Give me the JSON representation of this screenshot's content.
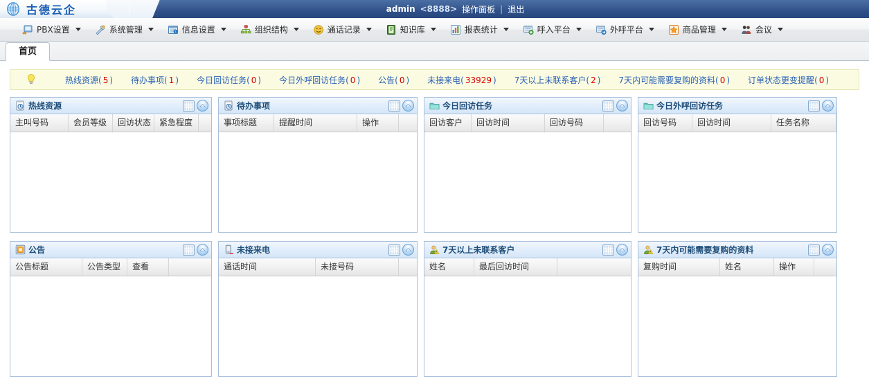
{
  "topbar": {
    "logo_text": "古德云企",
    "logo_icon": "globe-icon",
    "username": "admin",
    "extension": "<8888>",
    "panel_link": "操作面板",
    "separator": "|",
    "logout_link": "退出"
  },
  "menubar": {
    "items": [
      {
        "label": "PBX设置",
        "icon": "pbx-settings-icon"
      },
      {
        "label": "系统管理",
        "icon": "system-tools-icon"
      },
      {
        "label": "信息设置",
        "icon": "info-settings-icon"
      },
      {
        "label": "组织结构",
        "icon": "org-structure-icon"
      },
      {
        "label": "通话记录",
        "icon": "call-record-icon"
      },
      {
        "label": "知识库",
        "icon": "knowledge-book-icon"
      },
      {
        "label": "报表统计",
        "icon": "report-chart-icon"
      },
      {
        "label": "呼入平台",
        "icon": "inbound-platform-icon"
      },
      {
        "label": "外呼平台",
        "icon": "outbound-platform-icon"
      },
      {
        "label": "商品管理",
        "icon": "product-manage-icon"
      },
      {
        "label": "会议",
        "icon": "conference-icon"
      }
    ]
  },
  "tabs": [
    {
      "label": "首页",
      "active": true
    }
  ],
  "notice": {
    "icon": "lightbulb-icon",
    "links": [
      {
        "label": "热线资源",
        "count": "5"
      },
      {
        "label": "待办事项",
        "count": "1"
      },
      {
        "label": "今日回访任务",
        "count": "0"
      },
      {
        "label": "今日外呼回访任务",
        "count": "0"
      },
      {
        "label": "公告",
        "count": "0"
      },
      {
        "label": "未接来电",
        "count": "33929"
      },
      {
        "label": "7天以上未联系客户",
        "count": "2"
      },
      {
        "label": "7天内可能需要复购的资料",
        "count": "0"
      },
      {
        "label": "订单状态更变提醒",
        "count": "0"
      }
    ]
  },
  "panels": [
    {
      "title": "热线资源",
      "icon": "clock-doc-icon",
      "columns": [
        {
          "label": "主叫号码",
          "width": 84
        },
        {
          "label": "会员等级",
          "width": 64
        },
        {
          "label": "回访状态",
          "width": 60
        },
        {
          "label": "紧急程度",
          "width": 64
        },
        {
          "label": "",
          "width": 18
        }
      ],
      "rows": []
    },
    {
      "title": "待办事项",
      "icon": "clock-doc-icon",
      "columns": [
        {
          "label": "事项标题",
          "width": 80
        },
        {
          "label": "提醒时间",
          "width": 120
        },
        {
          "label": "操作",
          "width": 60
        },
        {
          "label": "",
          "width": 26
        }
      ],
      "rows": []
    },
    {
      "title": "今日回访任务",
      "icon": "folder-icon",
      "columns": [
        {
          "label": "回访客户",
          "width": 68
        },
        {
          "label": "回访时间",
          "width": 106
        },
        {
          "label": "回访号码",
          "width": 85
        },
        {
          "label": "",
          "width": 39
        }
      ],
      "rows": []
    },
    {
      "title": "今日外呼回访任务",
      "icon": "folder-icon",
      "columns": [
        {
          "label": "回访号码",
          "width": 78
        },
        {
          "label": "回访时间",
          "width": 114
        },
        {
          "label": "任务名称",
          "width": 94
        },
        {
          "label": "",
          "width": 0
        }
      ],
      "rows": []
    },
    {
      "title": "公告",
      "icon": "announcement-icon",
      "columns": [
        {
          "label": "公告标题",
          "width": 104
        },
        {
          "label": "公告类型",
          "width": 65
        },
        {
          "label": "查看",
          "width": 60
        },
        {
          "label": "",
          "width": 60
        }
      ],
      "rows": []
    },
    {
      "title": "未接来电",
      "icon": "missed-call-icon",
      "columns": [
        {
          "label": "通话时间",
          "width": 140
        },
        {
          "label": "未接号码",
          "width": 120
        },
        {
          "label": "",
          "width": 26
        }
      ],
      "rows": []
    },
    {
      "title": "7天以上未联系客户",
      "icon": "user-warn-icon",
      "columns": [
        {
          "label": "姓名",
          "width": 72
        },
        {
          "label": "最后回访时间",
          "width": 120
        },
        {
          "label": "",
          "width": 106
        }
      ],
      "rows": []
    },
    {
      "title": "7天内可能需要复购的资料",
      "icon": "user-warn-icon",
      "columns": [
        {
          "label": "复购时间",
          "width": 118
        },
        {
          "label": "姓名",
          "width": 78
        },
        {
          "label": "操作",
          "width": 58
        },
        {
          "label": "",
          "width": 30
        }
      ],
      "rows": []
    }
  ],
  "colors": {
    "header_blue": "#2f5089",
    "logo_blue": "#1a5fb4",
    "notice_bg": "#fbfbe2",
    "notice_link": "#2b62b5",
    "count_red": "#d40000",
    "panel_border": "#a7c0dc",
    "panel_head_blue": "#d4e6f8"
  }
}
